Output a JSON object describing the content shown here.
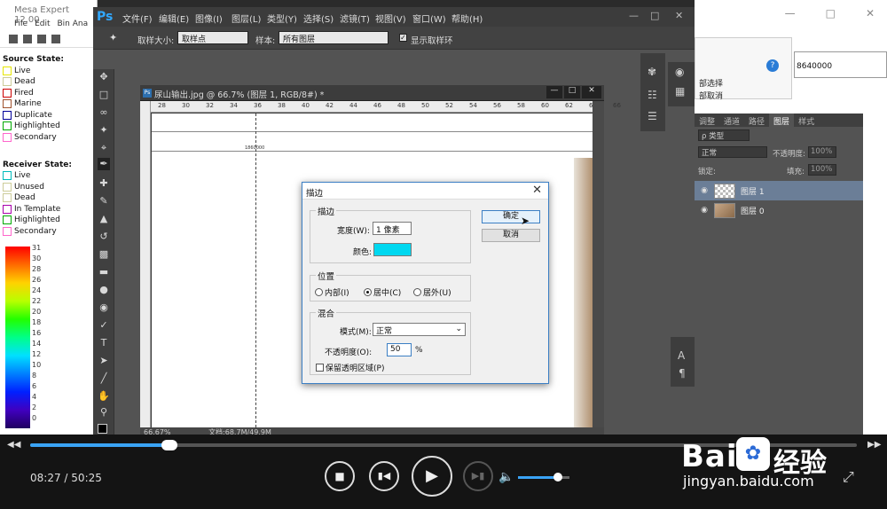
{
  "mesa": {
    "title": "Mesa Expert 12.00",
    "menu": [
      "File",
      "Edit",
      "Bin Ana"
    ],
    "source_state_title": "Source State:",
    "source_states": [
      {
        "label": "Live",
        "color": "#e6e600"
      },
      {
        "label": "Dead",
        "color": "#cccc99"
      },
      {
        "label": "Fired",
        "color": "#cc0000"
      },
      {
        "label": "Marine",
        "color": "#a0522d"
      },
      {
        "label": "Duplicate",
        "color": "#000099"
      },
      {
        "label": "Highlighted",
        "color": "#00aa00"
      },
      {
        "label": "Secondary",
        "color": "#ff66cc"
      }
    ],
    "receiver_state_title": "Receiver State:",
    "receiver_states": [
      {
        "label": "Live",
        "color": "#00bbbb"
      },
      {
        "label": "Unused",
        "color": "#cccc99"
      },
      {
        "label": "Dead",
        "color": "#cccc99"
      },
      {
        "label": "In Template",
        "color": "#aa00aa"
      },
      {
        "label": "Highlighted",
        "color": "#00aa00"
      },
      {
        "label": "Secondary",
        "color": "#ff66cc"
      }
    ],
    "scale_values": [
      "31",
      "30",
      "28",
      "26",
      "24",
      "22",
      "20",
      "18",
      "16",
      "14",
      "12",
      "10",
      "8",
      "6",
      "4",
      "2",
      "0"
    ]
  },
  "right_window": {
    "line1": "部选择",
    "line2": "部取消",
    "value": "8640000"
  },
  "ps": {
    "logo": "Ps",
    "menus": [
      "文件(F)",
      "编辑(E)",
      "图像(I)",
      "图层(L)",
      "类型(Y)",
      "选择(S)",
      "滤镜(T)",
      "视图(V)",
      "窗口(W)",
      "帮助(H)"
    ],
    "options": {
      "sample_size_label": "取样大小:",
      "sample_size_value": "取样点",
      "sample_label": "样本:",
      "sample_value": "所有图层",
      "show_ring_label": "显示取样环"
    },
    "doc": {
      "tab_title": "尿山输出.jpg @ 66.7% (图层 1, RGB/8#) *",
      "ruler_marks": [
        "28",
        "30",
        "32",
        "34",
        "36",
        "38",
        "40",
        "42",
        "44",
        "46",
        "48",
        "50",
        "52",
        "54",
        "56",
        "58",
        "60",
        "62",
        "64",
        "66"
      ],
      "canvas_label": "1860000",
      "zoom": "66.67%",
      "doc_size": "文档:68.7M/49.9M"
    },
    "panel": {
      "tabs": [
        "调整",
        "通道",
        "路径",
        "图层",
        "样式"
      ],
      "active_tab": "图层",
      "filter_kind": "ρ 类型",
      "blend_mode": "正常",
      "opacity_label": "不透明度:",
      "opacity_value": "100%",
      "lock_label": "锁定:",
      "fill_label": "填充:",
      "fill_value": "100%",
      "layers": [
        {
          "name": "图层 1",
          "selected": true
        },
        {
          "name": "图层 0",
          "selected": false
        }
      ]
    }
  },
  "dialog": {
    "title": "描边",
    "stroke_group": "描边",
    "width_label": "宽度(W):",
    "width_value": "1 像素",
    "color_label": "颜色:",
    "stroke_color": "#00d8f0",
    "position_group": "位置",
    "positions": [
      "内部(I)",
      "居中(C)",
      "居外(U)"
    ],
    "selected_position": "居中(C)",
    "blend_group": "混合",
    "mode_label": "模式(M):",
    "mode_value": "正常",
    "opacity_label": "不透明度(O):",
    "opacity_value": "50",
    "opacity_unit": "%",
    "preserve_label": "保留透明区域(P)",
    "ok": "确定",
    "cancel": "取消"
  },
  "player": {
    "current_time": "08:27",
    "separator": "/",
    "total_time": "50:25",
    "progress": 0.168,
    "volume": 0.78,
    "accent": "#3aa3f5"
  },
  "watermark": {
    "brand": "Bai",
    "brand_cn": "经验",
    "url": "jingyan.baidu.com"
  }
}
